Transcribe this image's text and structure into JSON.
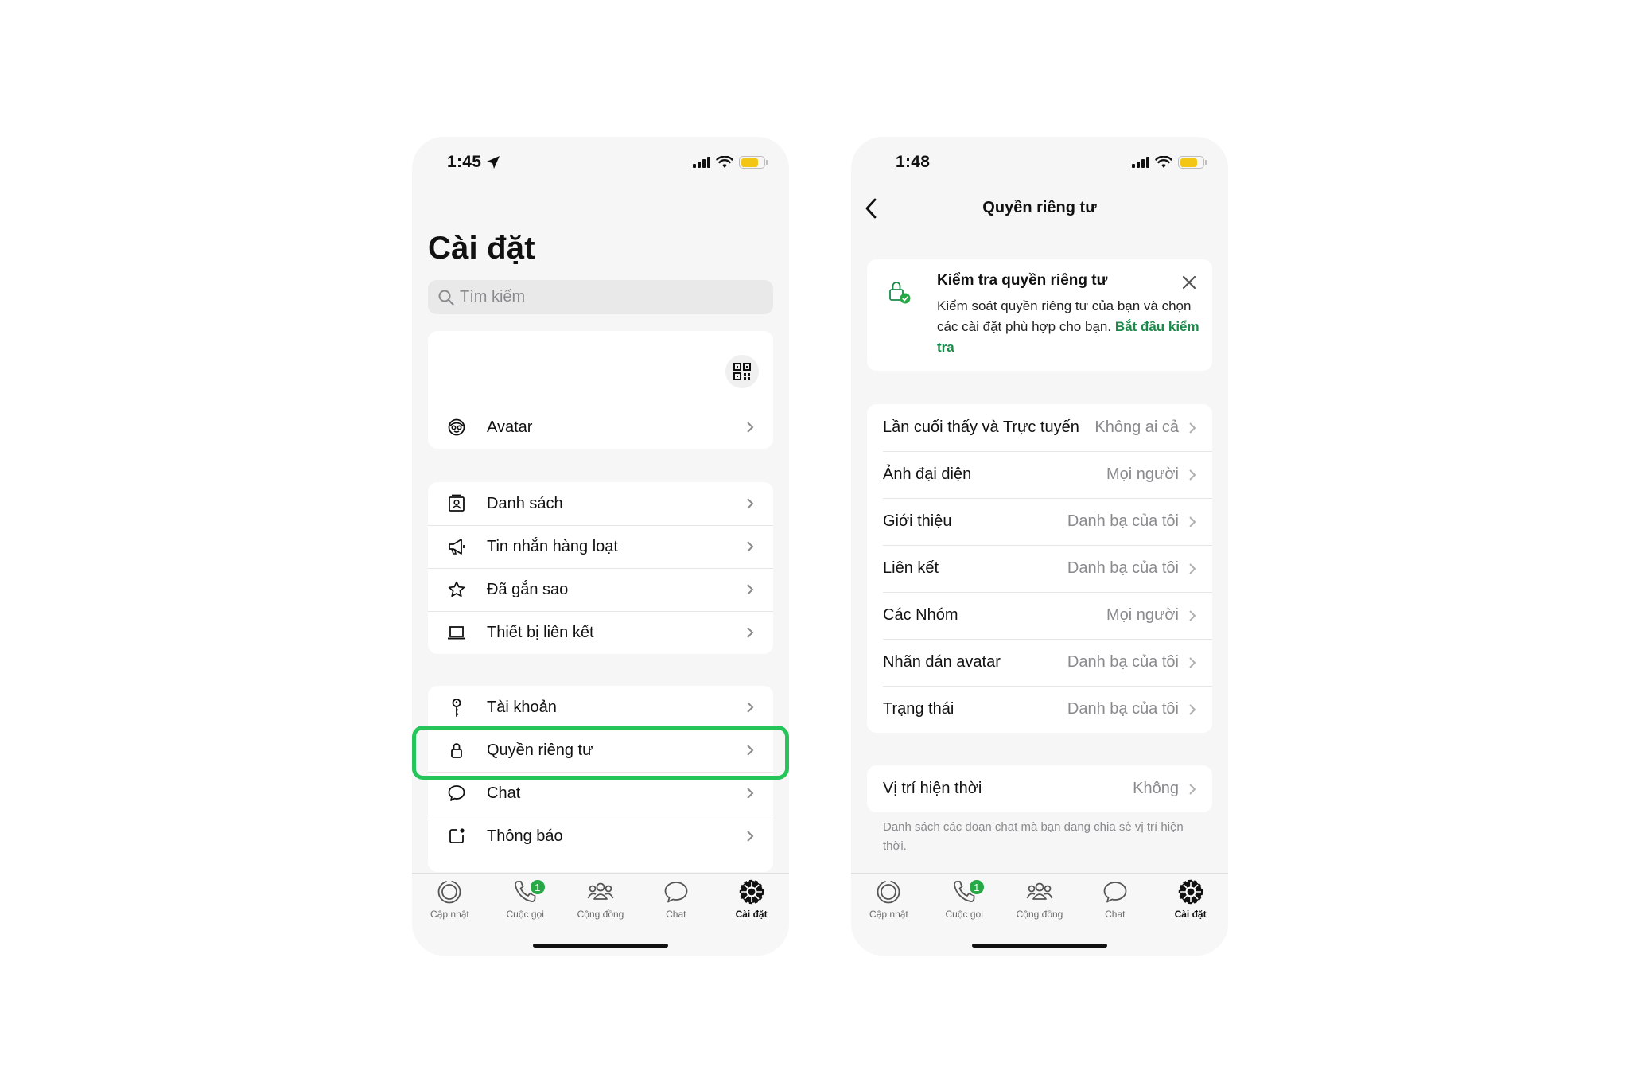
{
  "left": {
    "status_time": "1:45",
    "title": "Cài đặt",
    "search_placeholder": "Tìm kiếm",
    "avatar_label": "Avatar",
    "group1": [
      {
        "label": "Danh sách",
        "icon": "contacts-book-icon"
      },
      {
        "label": "Tin nhắn hàng loạt",
        "icon": "megaphone-icon"
      },
      {
        "label": "Đã gắn sao",
        "icon": "star-icon"
      },
      {
        "label": "Thiết bị liên kết",
        "icon": "laptop-icon"
      }
    ],
    "group2": [
      {
        "label": "Tài khoản",
        "icon": "key-icon"
      },
      {
        "label": "Quyền riêng tư",
        "icon": "lock-icon"
      },
      {
        "label": "Chat",
        "icon": "chat-bubble-icon"
      },
      {
        "label": "Thông báo",
        "icon": "notification-icon"
      }
    ]
  },
  "right": {
    "status_time": "1:48",
    "title": "Quyền riêng tư",
    "check": {
      "title": "Kiểm tra quyền riêng tư",
      "text": "Kiểm soát quyền riêng tư của bạn và chọn các cài đặt phù hợp cho bạn.",
      "link": "Bắt đầu kiểm tra"
    },
    "rows": [
      {
        "label": "Lần cuối thấy và Trực tuyến",
        "value": "Không ai cả"
      },
      {
        "label": "Ảnh đại diện",
        "value": "Mọi người"
      },
      {
        "label": "Giới thiệu",
        "value": "Danh bạ của tôi"
      },
      {
        "label": "Liên kết",
        "value": "Danh bạ của tôi"
      },
      {
        "label": "Các Nhóm",
        "value": "Mọi người"
      },
      {
        "label": "Nhãn dán avatar",
        "value": "Danh bạ của tôi"
      },
      {
        "label": "Trạng thái",
        "value": "Danh bạ của tôi"
      }
    ],
    "location": {
      "label": "Vị trí hiện thời",
      "value": "Không"
    },
    "footnote": "Danh sách các đoạn chat mà bạn đang chia sẻ vị trí hiện thời."
  },
  "nav": {
    "items": [
      "Cập nhật",
      "Cuộc gọi",
      "Cộng đồng",
      "Chat",
      "Cài đặt"
    ],
    "calls_badge": "1",
    "active": "Cài đặt"
  },
  "colors": {
    "highlight": "#25c55a",
    "accent_green": "#1a8a4a",
    "badge": "#25a845",
    "battery": "#f3c515"
  }
}
